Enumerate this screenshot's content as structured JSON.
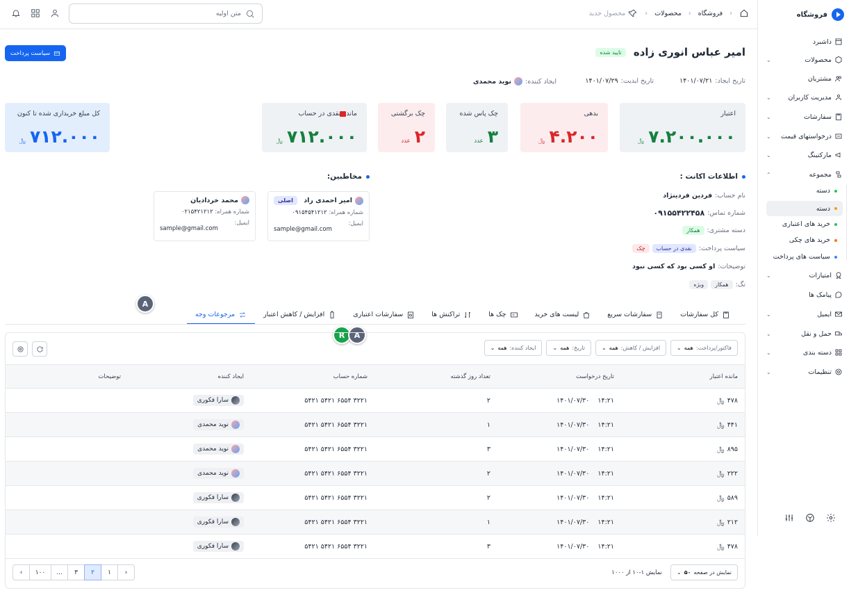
{
  "app": {
    "name": "فروشگاه"
  },
  "sidebar": {
    "items": [
      {
        "label": "داشبرد",
        "icon": "dashboard-icon",
        "chevron": false
      },
      {
        "label": "محصولات",
        "icon": "box-icon",
        "chevron": true
      },
      {
        "label": "مشتریان",
        "icon": "users-icon",
        "chevron": false
      },
      {
        "label": "مدیریت کاربران",
        "icon": "user-group-icon",
        "chevron": true
      },
      {
        "label": "سفارشات",
        "icon": "clipboard-icon",
        "chevron": true
      },
      {
        "label": "درخواستهای قیمت",
        "icon": "quote-icon",
        "chevron": true
      },
      {
        "label": "مارکتینگ",
        "icon": "megaphone-icon",
        "chevron": true
      },
      {
        "label": "مجموعه",
        "icon": "collection-icon",
        "chevron": true,
        "expanded": true
      },
      {
        "label": "امتیازات",
        "icon": "badge-icon",
        "chevron": true
      },
      {
        "label": "پیامک ها",
        "icon": "message-icon",
        "chevron": false
      },
      {
        "label": "ایمیل",
        "icon": "mail-icon",
        "chevron": true
      },
      {
        "label": "حمل و نقل",
        "icon": "truck-icon",
        "chevron": true
      },
      {
        "label": "دسته بندی",
        "icon": "grid-icon",
        "chevron": true
      },
      {
        "label": "تنظیمات",
        "icon": "gear-icon",
        "chevron": true
      }
    ],
    "subitems": [
      {
        "label": "دسته",
        "color": "#22c55e",
        "active": false
      },
      {
        "label": "دسته",
        "color": "#f59e0b",
        "active": true
      },
      {
        "label": "خرید های اعتباری",
        "color": "#22c55e",
        "active": false
      },
      {
        "label": "خرید های چکی",
        "color": "#f97316",
        "active": false
      },
      {
        "label": "سیاست های پرداخت",
        "color": "#3b82f6",
        "active": false
      }
    ]
  },
  "topbar": {
    "search_placeholder": "متن اولیه",
    "crumbs": [
      "فروشگاه",
      "محصولات",
      "محصول جدید"
    ]
  },
  "header": {
    "title": "امیر عباس انوری زاده",
    "status": "تایید شده",
    "payment_policy_button": "سیاست پرداخت",
    "created_date_label": "تاریخ ایجاد:",
    "created_date": "۱۴۰۱/۰۷/۲۱",
    "edit_date_label": "تاریخ ایدیت:",
    "edit_date": "۱۴۰۱/۰۷/۲۹",
    "creator_label": "ایجاد کننده:",
    "creator": "نوید محمدی"
  },
  "cards": [
    {
      "label": "اعتبار",
      "value": "۷.۲۰۰.۰۰۰",
      "unit": "﷼",
      "color": "#15803d",
      "bg": "#eef2f5"
    },
    {
      "label": "بدهی",
      "value": "۴.۲۰۰",
      "unit": "﷼",
      "color": "#dc2626",
      "bg": "#fdecee"
    },
    {
      "label": "چک پاس شده",
      "value": "۳",
      "unit": "عدد",
      "color": "#15803d",
      "bg": "#eef2f5"
    },
    {
      "label": "چک برگشتی",
      "value": "۲",
      "unit": "عدد",
      "color": "#dc2626",
      "bg": "#fdecee"
    },
    {
      "label": "مانده نقدی در حساب",
      "value": "۷۱۲.۰۰۰",
      "unit": "﷼",
      "color": "#15803d",
      "bg": "#eef2f5"
    },
    {
      "label": "کل مبلغ خریداری شده تا کنون",
      "value": "۷۱۲.۰۰۰",
      "unit": "﷼",
      "color": "#1565f0",
      "bg": "#e3eefd"
    }
  ],
  "account": {
    "title": "اطلاعات اکانت :",
    "name_label": "نام حساب:",
    "name": "فردین فردینژاد",
    "phone_label": "شماره تماس:",
    "phone": "۰۹۱۵۵۴۲۲۴۵۸",
    "group_label": "دسته مشتری:",
    "group": "همکار",
    "policy_label": "سیاست پرداخت:",
    "policy_1": "نقدی در حساب",
    "policy_2": "چک",
    "desc_label": "توضیحات:",
    "desc": "او کسی بود که کسی نبود",
    "tags_label": "تگ:",
    "tag_1": "همکار",
    "tag_2": "ویژه"
  },
  "contacts": {
    "title": "مخاطبین:",
    "items": [
      {
        "name": "امیر احمدی راد",
        "primary": "اصلی",
        "phone_label": "شماره همراه:",
        "phone": "۰۹۱۵۴۵۴۱۲۱۲",
        "email_label": "ایمیل:",
        "email": "sample@gmail.com"
      },
      {
        "name": "محمد خردادیان",
        "primary": "",
        "phone_label": "شماره همراه:",
        "phone": "۰۲۱۵۴۲۱۲۱۲",
        "email_label": "ایمیل:",
        "email": "sample@gmail.com"
      }
    ]
  },
  "tabs": [
    {
      "label": "کل سفارشات",
      "icon": "clipboard-icon"
    },
    {
      "label": "سفارشات سریع",
      "icon": "fast-order-icon"
    },
    {
      "label": "لیست های خرید",
      "icon": "bag-icon"
    },
    {
      "label": "چک ها",
      "icon": "cheque-icon"
    },
    {
      "label": "تراکنش ها",
      "icon": "transaction-icon"
    },
    {
      "label": "سفارشات اعتباری",
      "icon": "credit-order-icon"
    },
    {
      "label": "افزایش / کاهش اعتبار",
      "icon": "battery-icon"
    },
    {
      "label": "مرجوعات وجه",
      "icon": "refund-icon",
      "active": true
    }
  ],
  "collaborators": [
    {
      "letter": "A",
      "color": "#5a6478"
    },
    {
      "letter": "R",
      "color": "#16a34a"
    },
    {
      "letter": "A",
      "color": "#5a6478"
    }
  ],
  "filters": [
    {
      "label": "فاکتور/پرداخت:",
      "value": "همه"
    },
    {
      "label": "افزایش / کاهش:",
      "value": "همه"
    },
    {
      "label": "تاریخ:",
      "value": "همه"
    },
    {
      "label": "ایجاد کننده:",
      "value": "همه"
    }
  ],
  "table": {
    "columns": [
      "مانده اعتبار",
      "تاریخ درخواست",
      "تعداد روز گذشته",
      "شماره حساب",
      "ایجاد کننده",
      "توضیحات"
    ],
    "rows": [
      {
        "balance": "۴۷۸",
        "time": "۱۴:۲۱",
        "date": "۱۴۰۱/۰۷/۳۰",
        "days": "۲",
        "account": "۵۴۲۱ ۵۴۲۱ ۶۵۵۴ ۳۲۲۱",
        "creator": "سارا فکوری",
        "dark": true
      },
      {
        "balance": "۴۴۱",
        "time": "۱۴:۲۱",
        "date": "۱۴۰۱/۰۷/۳۰",
        "days": "۱",
        "account": "۵۴۲۱ ۵۴۲۱ ۶۵۵۴ ۳۲۲۱",
        "creator": "نوید محمدی",
        "dark": false
      },
      {
        "balance": "۸۹۵",
        "time": "۱۴:۲۱",
        "date": "۱۴۰۱/۰۷/۳۰",
        "days": "۳",
        "account": "۵۴۲۱ ۵۴۲۱ ۶۵۵۴ ۳۲۲۱",
        "creator": "نوید محمدی",
        "dark": false
      },
      {
        "balance": "۲۲۲",
        "time": "۱۴:۲۱",
        "date": "۱۴۰۱/۰۷/۳۰",
        "days": "۲",
        "account": "۵۴۲۱ ۵۴۲۱ ۶۵۵۴ ۳۲۲۱",
        "creator": "نوید محمدی",
        "dark": false
      },
      {
        "balance": "۵۸۹",
        "time": "۱۴:۲۱",
        "date": "۱۴۰۱/۰۷/۳۰",
        "days": "۲",
        "account": "۵۴۲۱ ۵۴۲۱ ۶۵۵۴ ۳۲۲۱",
        "creator": "سارا فکوری",
        "dark": true
      },
      {
        "balance": "۲۱۲",
        "time": "۱۴:۲۱",
        "date": "۱۴۰۱/۰۷/۳۰",
        "days": "۱",
        "account": "۵۴۲۱ ۵۴۲۱ ۶۵۵۴ ۳۲۲۱",
        "creator": "سارا فکوری",
        "dark": true
      },
      {
        "balance": "۴۷۸",
        "time": "۱۴:۲۱",
        "date": "۱۴۰۱/۰۷/۳۰",
        "days": "۳",
        "account": "۵۴۲۱ ۵۴۲۱ ۶۵۵۴ ۳۲۲۱",
        "creator": "سارا فکوری",
        "dark": true
      }
    ],
    "currency": "﷼"
  },
  "pagination": {
    "per_page_label": "نمایش در صفحه",
    "per_page": "۵۰",
    "summary": "نمایش ۱-۱۰ از ۱۰۰۰",
    "pages": [
      "۱",
      "۲",
      "۳",
      "...",
      "۱۰۰"
    ],
    "current": "۲"
  }
}
